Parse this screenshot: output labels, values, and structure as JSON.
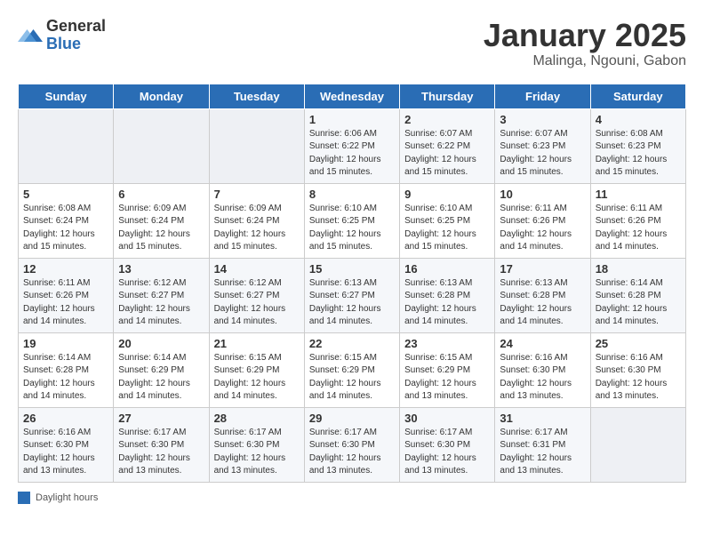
{
  "header": {
    "logo_general": "General",
    "logo_blue": "Blue",
    "month_title": "January 2025",
    "location": "Malinga, Ngouni, Gabon"
  },
  "days_of_week": [
    "Sunday",
    "Monday",
    "Tuesday",
    "Wednesday",
    "Thursday",
    "Friday",
    "Saturday"
  ],
  "weeks": [
    [
      {
        "day": "",
        "sunrise": "",
        "sunset": "",
        "daylight": "",
        "empty": true
      },
      {
        "day": "",
        "sunrise": "",
        "sunset": "",
        "daylight": "",
        "empty": true
      },
      {
        "day": "",
        "sunrise": "",
        "sunset": "",
        "daylight": "",
        "empty": true
      },
      {
        "day": "1",
        "sunrise": "Sunrise: 6:06 AM",
        "sunset": "Sunset: 6:22 PM",
        "daylight": "Daylight: 12 hours and 15 minutes."
      },
      {
        "day": "2",
        "sunrise": "Sunrise: 6:07 AM",
        "sunset": "Sunset: 6:22 PM",
        "daylight": "Daylight: 12 hours and 15 minutes."
      },
      {
        "day": "3",
        "sunrise": "Sunrise: 6:07 AM",
        "sunset": "Sunset: 6:23 PM",
        "daylight": "Daylight: 12 hours and 15 minutes."
      },
      {
        "day": "4",
        "sunrise": "Sunrise: 6:08 AM",
        "sunset": "Sunset: 6:23 PM",
        "daylight": "Daylight: 12 hours and 15 minutes."
      }
    ],
    [
      {
        "day": "5",
        "sunrise": "Sunrise: 6:08 AM",
        "sunset": "Sunset: 6:24 PM",
        "daylight": "Daylight: 12 hours and 15 minutes."
      },
      {
        "day": "6",
        "sunrise": "Sunrise: 6:09 AM",
        "sunset": "Sunset: 6:24 PM",
        "daylight": "Daylight: 12 hours and 15 minutes."
      },
      {
        "day": "7",
        "sunrise": "Sunrise: 6:09 AM",
        "sunset": "Sunset: 6:24 PM",
        "daylight": "Daylight: 12 hours and 15 minutes."
      },
      {
        "day": "8",
        "sunrise": "Sunrise: 6:10 AM",
        "sunset": "Sunset: 6:25 PM",
        "daylight": "Daylight: 12 hours and 15 minutes."
      },
      {
        "day": "9",
        "sunrise": "Sunrise: 6:10 AM",
        "sunset": "Sunset: 6:25 PM",
        "daylight": "Daylight: 12 hours and 15 minutes."
      },
      {
        "day": "10",
        "sunrise": "Sunrise: 6:11 AM",
        "sunset": "Sunset: 6:26 PM",
        "daylight": "Daylight: 12 hours and 14 minutes."
      },
      {
        "day": "11",
        "sunrise": "Sunrise: 6:11 AM",
        "sunset": "Sunset: 6:26 PM",
        "daylight": "Daylight: 12 hours and 14 minutes."
      }
    ],
    [
      {
        "day": "12",
        "sunrise": "Sunrise: 6:11 AM",
        "sunset": "Sunset: 6:26 PM",
        "daylight": "Daylight: 12 hours and 14 minutes."
      },
      {
        "day": "13",
        "sunrise": "Sunrise: 6:12 AM",
        "sunset": "Sunset: 6:27 PM",
        "daylight": "Daylight: 12 hours and 14 minutes."
      },
      {
        "day": "14",
        "sunrise": "Sunrise: 6:12 AM",
        "sunset": "Sunset: 6:27 PM",
        "daylight": "Daylight: 12 hours and 14 minutes."
      },
      {
        "day": "15",
        "sunrise": "Sunrise: 6:13 AM",
        "sunset": "Sunset: 6:27 PM",
        "daylight": "Daylight: 12 hours and 14 minutes."
      },
      {
        "day": "16",
        "sunrise": "Sunrise: 6:13 AM",
        "sunset": "Sunset: 6:28 PM",
        "daylight": "Daylight: 12 hours and 14 minutes."
      },
      {
        "day": "17",
        "sunrise": "Sunrise: 6:13 AM",
        "sunset": "Sunset: 6:28 PM",
        "daylight": "Daylight: 12 hours and 14 minutes."
      },
      {
        "day": "18",
        "sunrise": "Sunrise: 6:14 AM",
        "sunset": "Sunset: 6:28 PM",
        "daylight": "Daylight: 12 hours and 14 minutes."
      }
    ],
    [
      {
        "day": "19",
        "sunrise": "Sunrise: 6:14 AM",
        "sunset": "Sunset: 6:28 PM",
        "daylight": "Daylight: 12 hours and 14 minutes."
      },
      {
        "day": "20",
        "sunrise": "Sunrise: 6:14 AM",
        "sunset": "Sunset: 6:29 PM",
        "daylight": "Daylight: 12 hours and 14 minutes."
      },
      {
        "day": "21",
        "sunrise": "Sunrise: 6:15 AM",
        "sunset": "Sunset: 6:29 PM",
        "daylight": "Daylight: 12 hours and 14 minutes."
      },
      {
        "day": "22",
        "sunrise": "Sunrise: 6:15 AM",
        "sunset": "Sunset: 6:29 PM",
        "daylight": "Daylight: 12 hours and 14 minutes."
      },
      {
        "day": "23",
        "sunrise": "Sunrise: 6:15 AM",
        "sunset": "Sunset: 6:29 PM",
        "daylight": "Daylight: 12 hours and 13 minutes."
      },
      {
        "day": "24",
        "sunrise": "Sunrise: 6:16 AM",
        "sunset": "Sunset: 6:30 PM",
        "daylight": "Daylight: 12 hours and 13 minutes."
      },
      {
        "day": "25",
        "sunrise": "Sunrise: 6:16 AM",
        "sunset": "Sunset: 6:30 PM",
        "daylight": "Daylight: 12 hours and 13 minutes."
      }
    ],
    [
      {
        "day": "26",
        "sunrise": "Sunrise: 6:16 AM",
        "sunset": "Sunset: 6:30 PM",
        "daylight": "Daylight: 12 hours and 13 minutes."
      },
      {
        "day": "27",
        "sunrise": "Sunrise: 6:17 AM",
        "sunset": "Sunset: 6:30 PM",
        "daylight": "Daylight: 12 hours and 13 minutes."
      },
      {
        "day": "28",
        "sunrise": "Sunrise: 6:17 AM",
        "sunset": "Sunset: 6:30 PM",
        "daylight": "Daylight: 12 hours and 13 minutes."
      },
      {
        "day": "29",
        "sunrise": "Sunrise: 6:17 AM",
        "sunset": "Sunset: 6:30 PM",
        "daylight": "Daylight: 12 hours and 13 minutes."
      },
      {
        "day": "30",
        "sunrise": "Sunrise: 6:17 AM",
        "sunset": "Sunset: 6:30 PM",
        "daylight": "Daylight: 12 hours and 13 minutes."
      },
      {
        "day": "31",
        "sunrise": "Sunrise: 6:17 AM",
        "sunset": "Sunset: 6:31 PM",
        "daylight": "Daylight: 12 hours and 13 minutes."
      },
      {
        "day": "",
        "sunrise": "",
        "sunset": "",
        "daylight": "",
        "empty": true
      }
    ]
  ],
  "footer": {
    "label": "Daylight hours"
  }
}
